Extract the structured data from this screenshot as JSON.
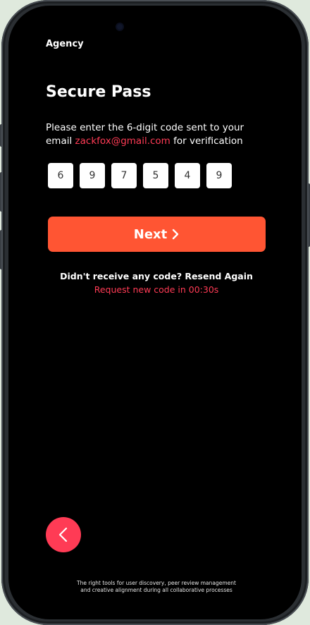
{
  "app": {
    "brand": "Agency"
  },
  "verification": {
    "title": "Secure Pass",
    "instruction_prefix": "Please enter the 6-digit code sent to your email",
    "email": "zackfox@gmail.com",
    "instruction_suffix": "for verification",
    "code_digits": [
      "6",
      "9",
      "7",
      "5",
      "4",
      "9"
    ]
  },
  "actions": {
    "next_label": "Next",
    "resend_text": "Didn't receive any code? Resend Again",
    "timer_text": "Request new code in 00:30s"
  },
  "footer": {
    "line1": "The right tools for user discovery, peer review management",
    "line2": "and creative alignment during all collaborative processes"
  },
  "colors": {
    "accent": "#ff5533",
    "link": "#ff3b55",
    "background": "#000000"
  }
}
